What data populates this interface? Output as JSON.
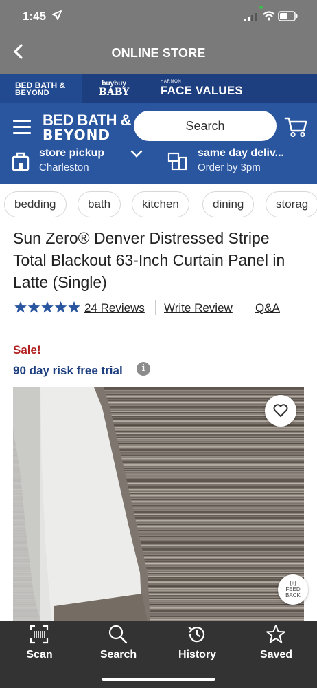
{
  "status_bar": {
    "time": "1:45"
  },
  "nav": {
    "title": "ONLINE STORE"
  },
  "brands": {
    "bbb_line1": "BED BATH &",
    "bbb_line2": "BEYOND",
    "buybuy_line1": "buybuy",
    "buybuy_line2": "BABY",
    "harmon_small": "HARMON",
    "harmon_big": "FACE VALUES"
  },
  "header": {
    "logo_line1": "BED BATH &",
    "logo_line2": "BEYOND",
    "search_placeholder": "Search",
    "store_pickup_title": "store pickup",
    "store_pickup_location": "Charleston",
    "same_day_title": "same day deliv...",
    "same_day_sub": "Order by 3pm"
  },
  "categories": [
    "bedding",
    "bath",
    "kitchen",
    "dining",
    "storag"
  ],
  "product": {
    "title": "Sun Zero® Denver Distressed Stripe Total Blackout 63-Inch Curtain Panel in Latte (Single)",
    "rating": 5,
    "reviews_label": "24 Reviews",
    "write_review_label": "Write Review",
    "qa_label": "Q&A",
    "sale_label": "Sale!",
    "trial_label": "90 day risk free trial",
    "info_symbol": "i",
    "feedback_line1": "[+]",
    "feedback_line2": "FEED",
    "feedback_line3": "BACK"
  },
  "tabbar": {
    "items": [
      {
        "label": "Scan",
        "icon": "scan-icon"
      },
      {
        "label": "Search",
        "icon": "search-icon"
      },
      {
        "label": "History",
        "icon": "history-icon"
      },
      {
        "label": "Saved",
        "icon": "star-icon"
      }
    ]
  },
  "colors": {
    "brand_blue": "#2a56a0",
    "brand_dark_blue": "#1e3f7f",
    "sale_red": "#b21f1f",
    "nav_grey": "#7a7a7a",
    "tabbar": "#333333"
  }
}
